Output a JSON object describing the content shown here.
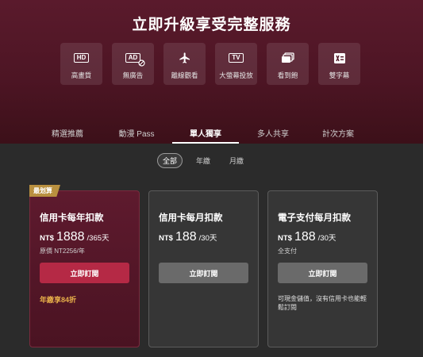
{
  "hero": {
    "title": "立即升級享受完整服務",
    "features": [
      {
        "icon": "hd-icon",
        "label": "高畫質"
      },
      {
        "icon": "no-ads-icon",
        "label": "無廣告"
      },
      {
        "icon": "airplane-icon",
        "label": "離線觀看"
      },
      {
        "icon": "tv-cast-icon",
        "label": "大螢幕投放"
      },
      {
        "icon": "binge-icon",
        "label": "看到飽"
      },
      {
        "icon": "dual-subtitle-icon",
        "label": "雙字幕"
      }
    ],
    "icon_text": {
      "hd": "HD",
      "ad": "AD",
      "tv": "TV"
    }
  },
  "tabs": [
    {
      "label": "精選推薦",
      "active": false
    },
    {
      "label": "動漫 Pass",
      "active": false
    },
    {
      "label": "單人獨享",
      "active": true
    },
    {
      "label": "多人共享",
      "active": false
    },
    {
      "label": "計次方案",
      "active": false
    }
  ],
  "periods": [
    {
      "label": "全部",
      "active": true
    },
    {
      "label": "年繳",
      "active": false
    },
    {
      "label": "月繳",
      "active": false
    }
  ],
  "plans": [
    {
      "ribbon": "最划算",
      "title": "信用卡每年扣款",
      "currency": "NT$",
      "amount": "1888",
      "period": "/365天",
      "sub": "原價 NT2256/年",
      "button": "立即訂閱",
      "note": "年繳享84折"
    },
    {
      "title": "信用卡每月扣款",
      "currency": "NT$",
      "amount": "188",
      "period": "/30天",
      "button": "立即訂閱"
    },
    {
      "title": "電子支付每月扣款",
      "currency": "NT$",
      "amount": "188",
      "period": "/30天",
      "sub": "全支付",
      "button": "立即訂閱",
      "desc": "可現金儲值，沒有信用卡也能輕鬆訂閱"
    }
  ],
  "colors": {
    "brand": "#b52945",
    "accent_gold": "#e8b04a",
    "hero_bg": "#5a1a2c"
  }
}
